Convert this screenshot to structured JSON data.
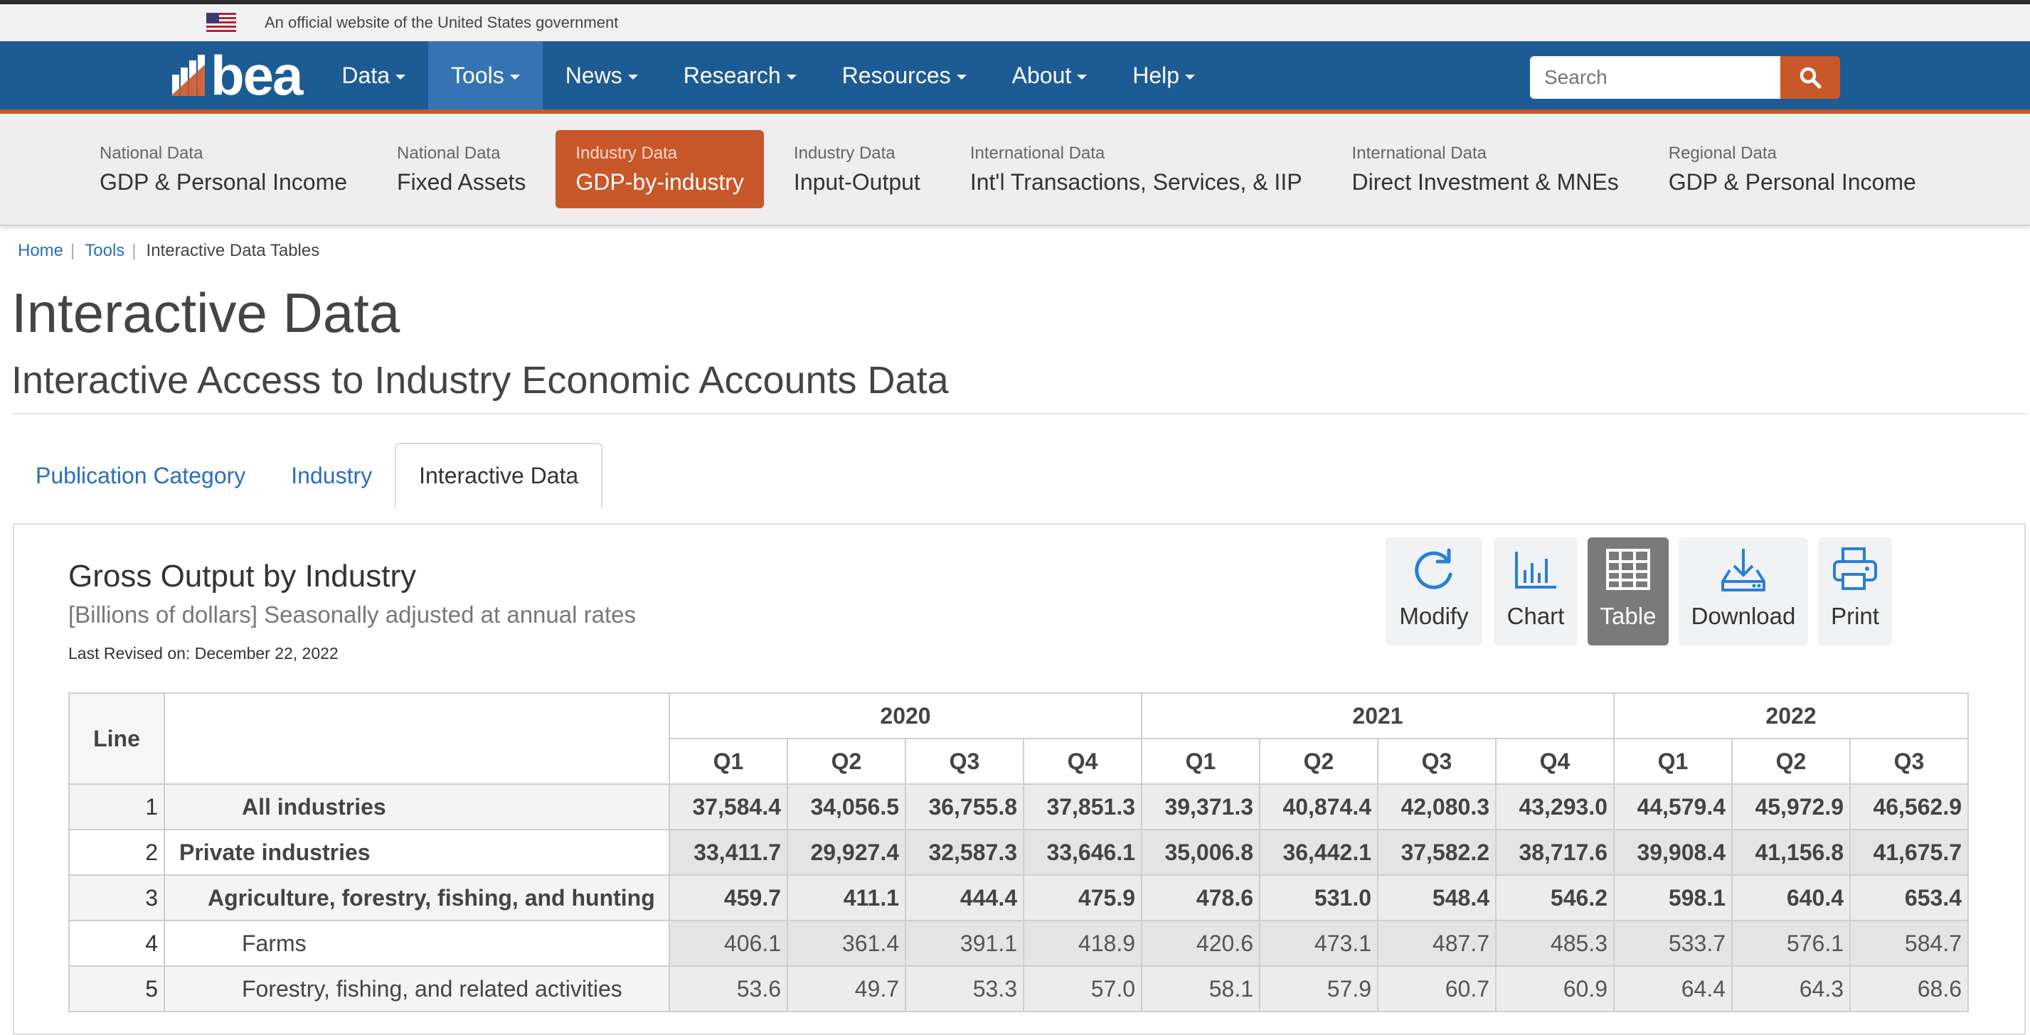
{
  "gov_banner": {
    "text": "An official website of the United States government"
  },
  "logo": {
    "text": "bea"
  },
  "nav": [
    {
      "label": "Data"
    },
    {
      "label": "Tools"
    },
    {
      "label": "News"
    },
    {
      "label": "Research"
    },
    {
      "label": "Resources"
    },
    {
      "label": "About"
    },
    {
      "label": "Help"
    }
  ],
  "nav_active": "Tools",
  "search": {
    "placeholder": "Search",
    "icon": "search-icon"
  },
  "subnav": [
    {
      "small": "National Data",
      "big": "GDP & Personal Income"
    },
    {
      "small": "National Data",
      "big": "Fixed Assets"
    },
    {
      "small": "Industry Data",
      "big": "GDP-by-industry"
    },
    {
      "small": "Industry Data",
      "big": "Input-Output"
    },
    {
      "small": "International Data",
      "big": "Int'l Transactions, Services, & IIP"
    },
    {
      "small": "International Data",
      "big": "Direct Investment & MNEs"
    },
    {
      "small": "Regional Data",
      "big": "GDP & Personal Income"
    }
  ],
  "subnav_active": "GDP-by-industry",
  "breadcrumb": {
    "home": "Home",
    "tools": "Tools",
    "current": "Interactive Data Tables"
  },
  "page": {
    "title": "Interactive Data",
    "subtitle": "Interactive Access to Industry Economic Accounts Data"
  },
  "tabs": [
    {
      "label": "Publication Category"
    },
    {
      "label": "Industry"
    },
    {
      "label": "Interactive Data"
    }
  ],
  "tabs_active": "Interactive Data",
  "table_info": {
    "title": "Gross Output by Industry",
    "units": "[Billions of dollars] Seasonally adjusted at annual rates",
    "revised": "Last Revised on: December 22, 2022"
  },
  "toolbar": {
    "modify": "Modify",
    "chart": "Chart",
    "table": "Table",
    "download": "Download",
    "print": "Print",
    "active": "Table"
  },
  "table": {
    "line_header": "Line",
    "years": [
      {
        "year": "2020",
        "span": 4
      },
      {
        "year": "2021",
        "span": 4
      },
      {
        "year": "2022",
        "span": 3
      }
    ],
    "quarters": [
      "Q1",
      "Q2",
      "Q3",
      "Q4",
      "Q1",
      "Q2",
      "Q3",
      "Q4",
      "Q1",
      "Q2",
      "Q3"
    ],
    "rows": [
      {
        "line": "1",
        "name": "All industries",
        "indent": 2,
        "bold": true,
        "values": [
          "37,584.4",
          "34,056.5",
          "36,755.8",
          "37,851.3",
          "39,371.3",
          "40,874.4",
          "42,080.3",
          "43,293.0",
          "44,579.4",
          "45,972.9",
          "46,562.9"
        ]
      },
      {
        "line": "2",
        "name": "Private industries",
        "indent": 0,
        "bold": true,
        "values": [
          "33,411.7",
          "29,927.4",
          "32,587.3",
          "33,646.1",
          "35,006.8",
          "36,442.1",
          "37,582.2",
          "38,717.6",
          "39,908.4",
          "41,156.8",
          "41,675.7"
        ]
      },
      {
        "line": "3",
        "name": "Agriculture, forestry, fishing, and hunting",
        "indent": 1,
        "bold": true,
        "values": [
          "459.7",
          "411.1",
          "444.4",
          "475.9",
          "478.6",
          "531.0",
          "548.4",
          "546.2",
          "598.1",
          "640.4",
          "653.4"
        ]
      },
      {
        "line": "4",
        "name": "Farms",
        "indent": 2,
        "bold": false,
        "values": [
          "406.1",
          "361.4",
          "391.1",
          "418.9",
          "420.6",
          "473.1",
          "487.7",
          "485.3",
          "533.7",
          "576.1",
          "584.7"
        ]
      },
      {
        "line": "5",
        "name": "Forestry, fishing, and related activities",
        "indent": 2,
        "bold": false,
        "values": [
          "53.6",
          "49.7",
          "53.3",
          "57.0",
          "58.1",
          "57.9",
          "60.7",
          "60.9",
          "64.4",
          "64.3",
          "68.6"
        ]
      }
    ]
  }
}
